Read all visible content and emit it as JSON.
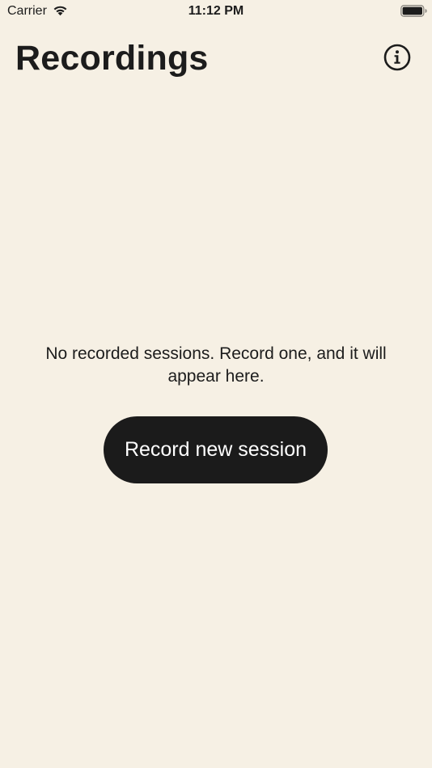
{
  "status_bar": {
    "carrier": "Carrier",
    "time": "11:12 PM",
    "wifi_icon": "wifi-icon",
    "battery_icon": "battery-icon"
  },
  "header": {
    "title": "Recordings",
    "info_icon": "info-icon"
  },
  "empty_state": {
    "message": "No recorded sessions. Record one, and it will appear here.",
    "button_label": "Record new session"
  },
  "colors": {
    "background": "#f6f0e4",
    "button_background": "#1b1b1b",
    "button_text": "#ffffff",
    "text": "#1c1c1c"
  }
}
